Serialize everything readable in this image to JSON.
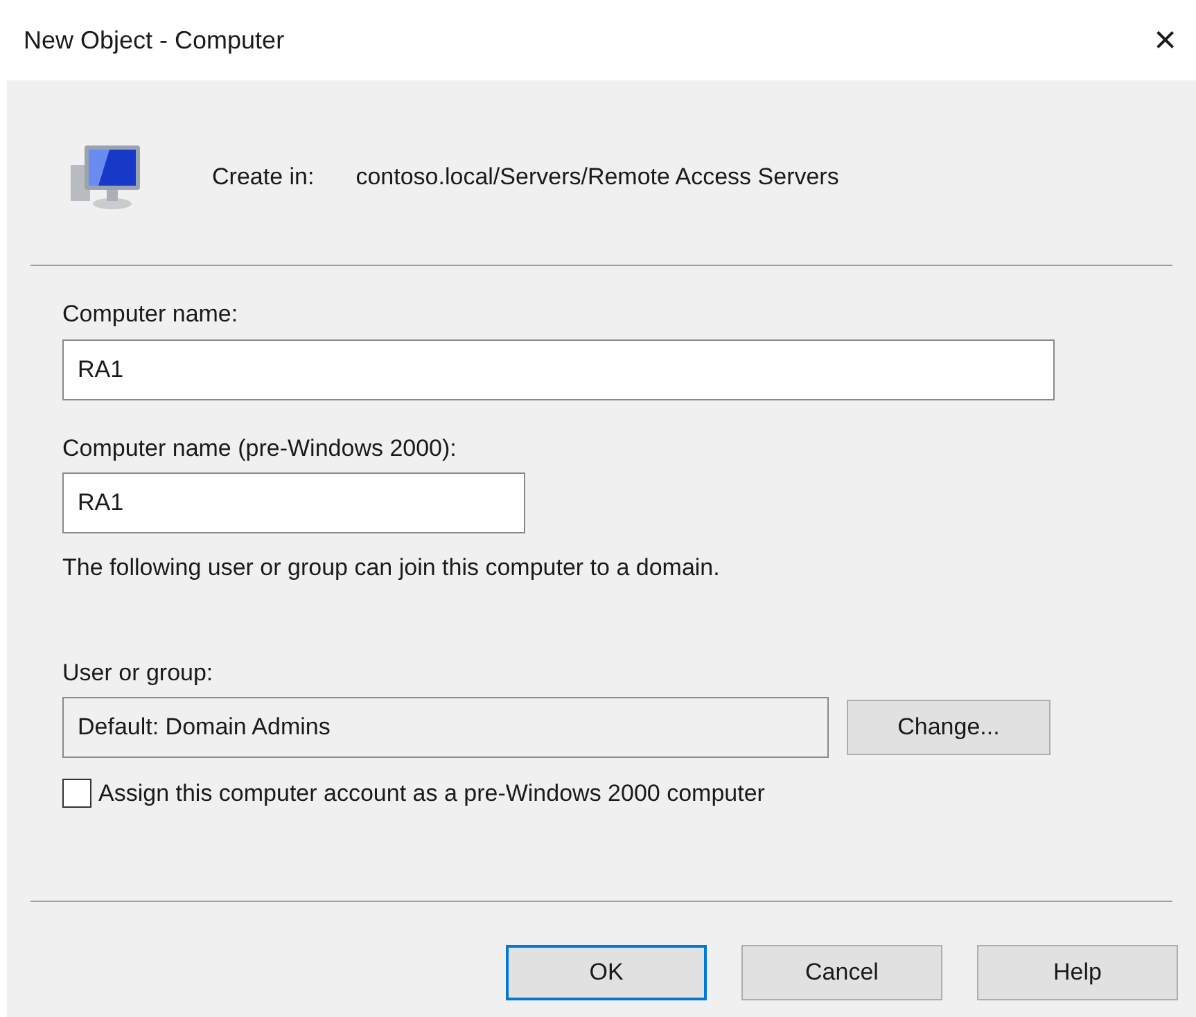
{
  "window": {
    "title": "New Object - Computer",
    "close": "×"
  },
  "create_in": {
    "label": "Create in:",
    "path": "contoso.local/Servers/Remote Access Servers"
  },
  "fields": [
    {
      "label": "Computer name:",
      "value": "RA1",
      "kind": "wide"
    },
    {
      "label": "Computer name (pre-Windows 2000):",
      "value": "RA1",
      "kind": "narrow"
    }
  ],
  "note": "The following user or group can join this computer to a domain.",
  "user_or_group": {
    "label": "User or group:",
    "value": "Default: Domain Admins",
    "disabled": true,
    "button": "Change..."
  },
  "checkbox": {
    "label": "Assign this computer account as a pre-Windows 2000 computer",
    "checked": false
  },
  "buttons": [
    {
      "label": "OK",
      "default": true
    },
    {
      "label": "Cancel",
      "default": false
    },
    {
      "label": "Help",
      "default": false
    }
  ]
}
